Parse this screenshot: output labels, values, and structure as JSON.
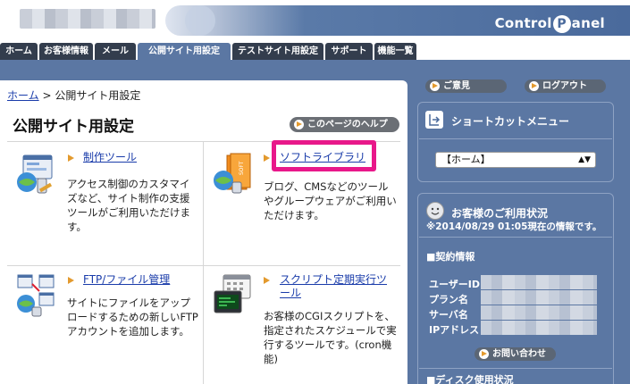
{
  "header": {
    "brand_before": "Control",
    "brand_p": "P",
    "brand_after": "anel"
  },
  "tabs": [
    "ホーム",
    "お客様情報",
    "メール",
    "公開サイト用設定",
    "テストサイト用設定",
    "サポート",
    "機能一覧"
  ],
  "breadcrumb": {
    "home": "ホーム",
    "sep": " > ",
    "current": "公開サイト用設定"
  },
  "page": {
    "title": "公開サイト用設定",
    "help_label": "このページのヘルプ"
  },
  "tools": [
    {
      "title": "制作ツール",
      "desc": "アクセス制御のカスタマイズなど、サイト制作の支援ツールがご利用いただけます。"
    },
    {
      "title": "ソフトライブラリ",
      "desc": "ブログ、CMSなどのツールやグループウェアがご利用いただけます。"
    },
    {
      "title": "FTP/ファイル管理",
      "desc": "サイトにファイルをアップロードするための新しいFTPアカウントを追加します。"
    },
    {
      "title": "スクリプト定期実行ツール",
      "desc": "お客様のCGIスクリプトを、指定されたスケジュールで実行するツールです。(cron機能)"
    }
  ],
  "sidebar": {
    "feedback_label": "ご意見",
    "logout_label": "ログアウト",
    "shortcut_title": "ショートカットメニュー",
    "shortcut_selected": "【ホーム】",
    "status_title": "お客様のご利用状況",
    "status_time": "※2014/08/29 01:05現在の情報です。",
    "contract_title": "■契約情報",
    "fields": [
      "ユーザーID",
      "プラン名",
      "サーバ名",
      "IPアドレス"
    ],
    "contact_label": "お問い合わせ",
    "disk_title": "■ディスク使用状況"
  },
  "colors": {
    "frame": "#5b77a3",
    "tab_dark": "#333d4d",
    "link": "#1a3caa",
    "highlight": "#e8188a",
    "arrow": "#e39a2e"
  }
}
